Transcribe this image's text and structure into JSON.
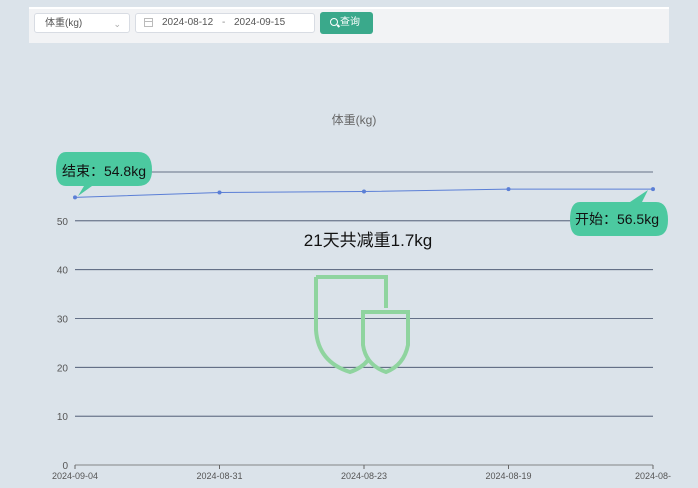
{
  "toolbar": {
    "select_value": "体重(kg)",
    "date_start": "2024-08-12",
    "date_sep": "-",
    "date_end": "2024-09-15",
    "search_label": "查询"
  },
  "colors": {
    "accent": "#3aa98b",
    "line": "#5b7fd6",
    "grid": "#3c4a66",
    "bubble": "#4cc9a0"
  },
  "chart_data": {
    "type": "line",
    "title": "体重(kg)",
    "categories": [
      "2024-09-04",
      "2024-08-31",
      "2024-08-23",
      "2024-08-19",
      "2024-08-"
    ],
    "values": [
      54.8,
      55.8,
      56.0,
      56.5,
      56.5
    ],
    "ylim": [
      0,
      60
    ],
    "yticks": [
      0,
      10,
      20,
      30,
      40,
      50
    ],
    "grid": true,
    "annotation": "21天共减重1.7kg",
    "end_label": "结束：54.8kg",
    "start_label": "开始：56.5kg"
  }
}
